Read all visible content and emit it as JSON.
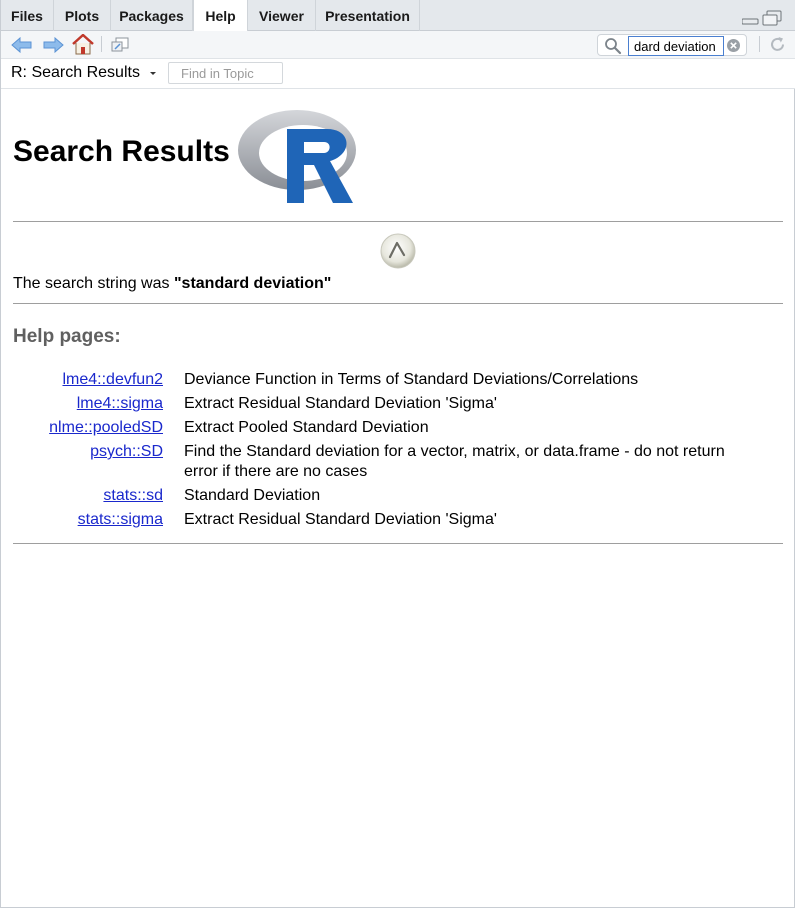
{
  "tabs": [
    {
      "label": "Files",
      "active": false
    },
    {
      "label": "Plots",
      "active": false
    },
    {
      "label": "Packages",
      "active": false
    },
    {
      "label": "Help",
      "active": true
    },
    {
      "label": "Viewer",
      "active": false
    },
    {
      "label": "Presentation",
      "active": false
    }
  ],
  "toolbar": {
    "search_value": "dard deviation"
  },
  "topicbar": {
    "title": "R: Search Results",
    "find_placeholder": "Find in Topic"
  },
  "page": {
    "title": "Search Results",
    "search_prefix": "The search string was ",
    "search_string": "\"standard deviation\"",
    "help_heading": "Help pages:"
  },
  "results": [
    {
      "link": "lme4::devfun2",
      "description": "Deviance Function in Terms of Standard Deviations/Correlations"
    },
    {
      "link": "lme4::sigma",
      "description": "Extract Residual Standard Deviation 'Sigma'"
    },
    {
      "link": "nlme::pooledSD",
      "description": "Extract Pooled Standard Deviation"
    },
    {
      "link": "psych::SD",
      "description": "Find the Standard deviation for a vector, matrix, or data.frame - do not return error if there are no cases"
    },
    {
      "link": "stats::sd",
      "description": "Standard Deviation"
    },
    {
      "link": "stats::sigma",
      "description": "Extract Residual Standard Deviation 'Sigma'"
    }
  ],
  "colors": {
    "link": "#1a28cc",
    "heading_gray": "#606060",
    "r_logo_blue": "#1f65b7",
    "arrow_blue": "#6fa8e6",
    "home_red": "#c0392b"
  },
  "icons": [
    "back-arrow-icon",
    "forward-arrow-icon",
    "home-icon",
    "show-in-window-icon",
    "search-icon",
    "clear-search-icon",
    "refresh-icon",
    "minimize-icon",
    "maximize-icon",
    "dropdown-caret-icon",
    "r-logo",
    "loading-spinner-icon"
  ]
}
